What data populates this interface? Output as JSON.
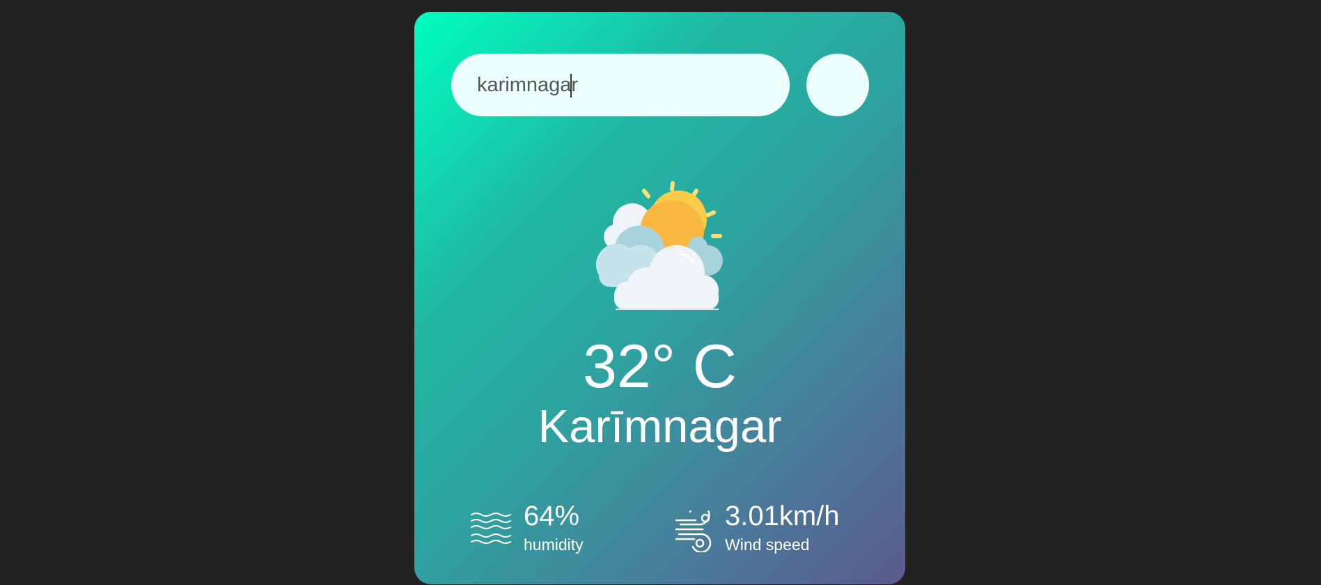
{
  "search": {
    "value": "karimnagar",
    "icon": "search-icon"
  },
  "weather": {
    "icon": "partly-cloudy-icon",
    "temperature": "32° C",
    "city": "Karīmnagar"
  },
  "details": {
    "humidity": {
      "value": "64%",
      "label": "humidity",
      "icon": "humidity-waves-icon"
    },
    "wind": {
      "value": "3.01km/h",
      "label": "Wind speed",
      "icon": "wind-icon"
    }
  },
  "colors": {
    "background": "#222222",
    "gradient_start": "#00fec0",
    "gradient_end": "#5b5a8e",
    "input_bg": "#ebfffc",
    "sun": "#f9b740",
    "sun_rays": "#f7e17a",
    "cloud": "#eef4f7",
    "cloud_shade": "#a9d3dc"
  }
}
